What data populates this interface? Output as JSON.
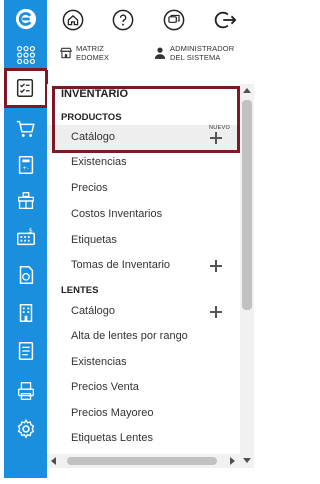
{
  "rail": {
    "items": [
      {
        "icon": "app-logo-icon"
      },
      {
        "icon": "apps-grid-icon"
      },
      {
        "icon": "inventory-checklist-icon",
        "active": true
      },
      {
        "icon": "cart-icon"
      },
      {
        "icon": "calculator-doc-icon"
      },
      {
        "icon": "store-icon"
      },
      {
        "icon": "cash-register-icon"
      },
      {
        "icon": "document-sync-icon"
      },
      {
        "icon": "building-icon"
      },
      {
        "icon": "report-doc-icon"
      },
      {
        "icon": "printer-doc-icon"
      },
      {
        "icon": "gear-icon"
      }
    ]
  },
  "topbar": {
    "icons": [
      "home-icon",
      "help-icon",
      "chat-icon",
      "logout-icon"
    ]
  },
  "subbar": {
    "branch_line1": "MATRIZ",
    "branch_line2": "EDOMEX",
    "user_line1": "ADMINISTRADOR",
    "user_line2": "DEL SISTEMA"
  },
  "menu": {
    "section_title": "INVENTARIO",
    "productos": {
      "title": "PRODUCTOS",
      "items": [
        "Catálogo",
        "Existencias",
        "Precios",
        "Costos Inventarios",
        "Etiquetas",
        "Tomas de Inventario"
      ],
      "new_badge": "NUEVO"
    },
    "lentes": {
      "title": "LENTES",
      "items": [
        "Catálogo",
        "Alta de lentes por rango",
        "Existencias",
        "Precios Venta",
        "Precios Mayoreo",
        "Etiquetas Lentes"
      ]
    }
  },
  "colors": {
    "rail": "#1a8fdd",
    "highlight": "#7b1a24"
  }
}
